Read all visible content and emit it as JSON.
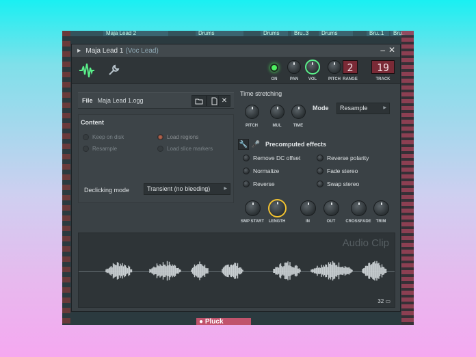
{
  "background": {
    "tabs": [
      "Maja Lead 2",
      "Drums",
      "Drums",
      "Bru..3",
      "Drums",
      "Bru..1",
      "Bru.."
    ],
    "bottom_tab": "Pluck"
  },
  "window": {
    "title": "Maja Lead 1",
    "subtitle": "(Voc Lead)",
    "minimize_label": "–",
    "close_label": "✕"
  },
  "toolbar": {
    "knob_labels": {
      "on": "ON",
      "pan": "PAN",
      "vol": "VOL",
      "pitch": "PITCH",
      "range": "RANGE",
      "track": "TRACK"
    },
    "range_value": "2",
    "track_value": "19"
  },
  "file": {
    "label": "File",
    "name": "Maja Lead 1.ogg"
  },
  "content": {
    "title": "Content",
    "options": [
      {
        "label": "Keep on disk",
        "checked": false
      },
      {
        "label": "Load regions",
        "checked": true
      },
      {
        "label": "Resample",
        "checked": false
      },
      {
        "label": "Load slice markers",
        "checked": false
      }
    ],
    "declicking_label": "Declicking mode",
    "declicking_value": "Transient (no bleeding)"
  },
  "time_stretching": {
    "title": "Time stretching",
    "knobs": [
      "PITCH",
      "MUL",
      "TIME"
    ],
    "mode_label": "Mode",
    "mode_value": "Resample"
  },
  "precomputed": {
    "title": "Precomputed effects",
    "options": [
      "Remove DC offset",
      "Reverse polarity",
      "Normalize",
      "Fade stereo",
      "Reverse",
      "Swap stereo"
    ],
    "knobs": [
      "SMP START",
      "LENGTH",
      "IN",
      "OUT",
      "CROSSFADE",
      "TRIM"
    ]
  },
  "waveform": {
    "title": "Audio Clip",
    "count": "32"
  },
  "colors": {
    "accent_green": "#5af08a",
    "accent_yellow": "#f2c230",
    "lcd_red": "#7a2a36"
  }
}
